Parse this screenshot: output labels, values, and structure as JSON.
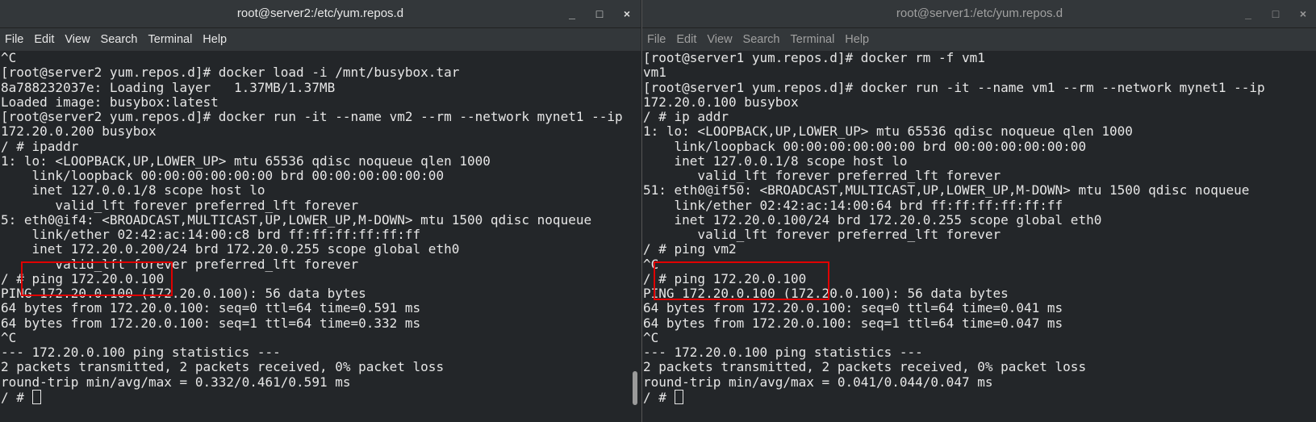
{
  "left": {
    "title": "root@server2:/etc/yum.repos.d",
    "menu": [
      "File",
      "Edit",
      "View",
      "Search",
      "Terminal",
      "Help"
    ],
    "lines": [
      "^C",
      "[root@server2 yum.repos.d]# docker load -i /mnt/busybox.tar",
      "8a788232037e: Loading layer   1.37MB/1.37MB",
      "Loaded image: busybox:latest",
      "[root@server2 yum.repos.d]# docker run -it --name vm2 --rm --network mynet1 --ip",
      "172.20.0.200 busybox",
      "/ # ipaddr",
      "1: lo: <LOOPBACK,UP,LOWER_UP> mtu 65536 qdisc noqueue qlen 1000",
      "    link/loopback 00:00:00:00:00:00 brd 00:00:00:00:00:00",
      "    inet 127.0.0.1/8 scope host lo",
      "       valid_lft forever preferred_lft forever",
      "5: eth0@if4: <BROADCAST,MULTICAST,UP,LOWER_UP,M-DOWN> mtu 1500 qdisc noqueue",
      "    link/ether 02:42:ac:14:00:c8 brd ff:ff:ff:ff:ff:ff",
      "    inet 172.20.0.200/24 brd 172.20.0.255 scope global eth0",
      "       valid_lft forever preferred_lft forever",
      "/ # ping 172.20.0.100",
      "PING 172.20.0.100 (172.20.0.100): 56 data bytes",
      "64 bytes from 172.20.0.100: seq=0 ttl=64 time=0.591 ms",
      "64 bytes from 172.20.0.100: seq=1 ttl=64 time=0.332 ms",
      "^C",
      "--- 172.20.0.100 ping statistics ---",
      "2 packets transmitted, 2 packets received, 0% packet loss",
      "round-trip min/avg/max = 0.332/0.461/0.591 ms"
    ],
    "prompt": "/ # "
  },
  "right": {
    "title": "root@server1:/etc/yum.repos.d",
    "menu": [
      "File",
      "Edit",
      "View",
      "Search",
      "Terminal",
      "Help"
    ],
    "lines": [
      "[root@server1 yum.repos.d]# docker rm -f vm1",
      "vm1",
      "[root@server1 yum.repos.d]# docker run -it --name vm1 --rm --network mynet1 --ip",
      "172.20.0.100 busybox",
      "/ # ip addr",
      "1: lo: <LOOPBACK,UP,LOWER_UP> mtu 65536 qdisc noqueue qlen 1000",
      "    link/loopback 00:00:00:00:00:00 brd 00:00:00:00:00:00",
      "    inet 127.0.0.1/8 scope host lo",
      "       valid_lft forever preferred_lft forever",
      "51: eth0@if50: <BROADCAST,MULTICAST,UP,LOWER_UP,M-DOWN> mtu 1500 qdisc noqueue",
      "    link/ether 02:42:ac:14:00:64 brd ff:ff:ff:ff:ff:ff",
      "    inet 172.20.0.100/24 brd 172.20.0.255 scope global eth0",
      "       valid_lft forever preferred_lft forever",
      "/ # ping vm2",
      "^C",
      "/ # ping 172.20.0.100",
      "PING 172.20.0.100 (172.20.0.100): 56 data bytes",
      "64 bytes from 172.20.0.100: seq=0 ttl=64 time=0.041 ms",
      "64 bytes from 172.20.0.100: seq=1 ttl=64 time=0.047 ms",
      "^C",
      "--- 172.20.0.100 ping statistics ---",
      "2 packets transmitted, 2 packets received, 0% packet loss",
      "round-trip min/avg/max = 0.041/0.044/0.047 ms"
    ],
    "prompt": "/ # "
  },
  "colors": {
    "highlight_box": "#e00000",
    "terminal_bg": "#232629",
    "titlebar_bg": "#33373a"
  }
}
